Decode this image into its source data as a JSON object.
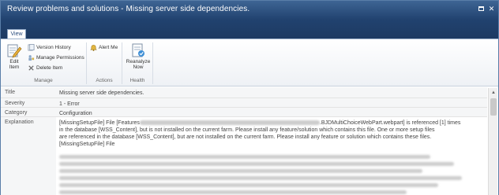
{
  "window": {
    "title": "Review problems and solutions - Missing server side dependencies."
  },
  "ribbon": {
    "tab": "View",
    "groups": {
      "manage": {
        "label": "Manage",
        "edit_item": [
          "Edit",
          "Item"
        ],
        "version_history": "Version History",
        "manage_permissions": "Manage Permissions",
        "delete_item": "Delete Item"
      },
      "actions": {
        "label": "Actions",
        "alert_me": "Alert Me"
      },
      "health": {
        "label": "Health",
        "reanalyze": [
          "Reanalyze",
          "Now"
        ]
      }
    }
  },
  "fields": {
    "title_label": "Title",
    "title_value": "Missing server side dependencies.",
    "severity_label": "Severity",
    "severity_value": "1 - Error",
    "category_label": "Category",
    "category_value": "Configuration",
    "explanation_label": "Explanation",
    "explanation": {
      "line1_start": "[MissingSetupFile] File [Features",
      "line1_end": ".BJDMultiChoiceWebPart.webpart] is referenced [1] times",
      "line2": "in the database [WSS_Content], but is not installed on the current farm. Please install any feature/solution which contains this file. One or more setup files",
      "line3": "are referenced in the database [WSS_Content], but are not installed on the current farm. Please install any feature or solution which contains these files.",
      "line4": "[MissingSetupFile] File"
    }
  },
  "colors": {
    "titlebar": "#2c5281",
    "ribbon_bg": "#ffffff",
    "label_shade": "#f5f6f7"
  }
}
